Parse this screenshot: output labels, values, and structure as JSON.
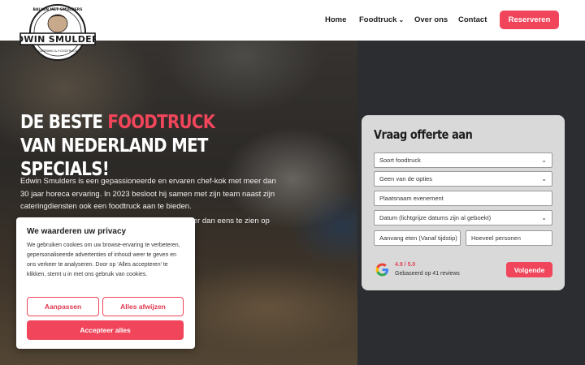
{
  "header": {
    "logo_top_text": "BALLEN MET SMULDERS",
    "logo_name": "EDWIN SMULDERS",
    "logo_bottom_text": "CATERING & FOODTRUCK",
    "nav": [
      {
        "label": "Home"
      },
      {
        "label": "Foodtruck"
      },
      {
        "label": "Over ons"
      },
      {
        "label": "Contact"
      }
    ],
    "cta_label": "Reserveren"
  },
  "hero": {
    "title_part1": "De beste ",
    "title_accent": "foodtruck",
    "title_part2": " van Nederland met specials!",
    "paragraph1": "Edwin Smulders is een gepassioneerde en ervaren chef-kok met meer dan 30 jaar horeca ervaring. In 2023 besloot hij samen met zijn team naast zijn cateringdiensten ook een foodtruck aan te bieden.",
    "paragraph2": "De Smulders Foodtruck was na de lancering al meer dan eens te zien op evenementen van deze culinaire beleving."
  },
  "form": {
    "title": "Vraag offerte aan",
    "fields": {
      "soort": "Soort foodtruck",
      "opties": "Geen van de opties",
      "plaats": "Plaatsnaam evenement",
      "datum": "Datum (lichtgrijze datums zijn al geboekt)",
      "aanvang": "Aanvang eten (Vanaf tijdstip)",
      "personen": "Hoeveel personen"
    },
    "rating": "4.9 / 5.0",
    "reviews": "Gebaseerd op 41 reviews",
    "next_label": "Volgende"
  },
  "cookie": {
    "title": "We waarderen uw privacy",
    "text": "We gebruiken cookies om uw browse-ervaring te verbeteren, gepersonaliseerde advertenties of inhoud weer te geven en ons verkeer te analyseren. Door op ‘Alles accepteren’ te klikken, stemt u in met ons gebruik van cookies.",
    "customize_label": "Aanpassen",
    "reject_label": "Alles afwijzen",
    "accept_label": "Accepteer alles"
  },
  "colors": {
    "accent": "#f0455a",
    "dark_panel": "#2b2d30",
    "form_bg": "#d9d9d9"
  }
}
